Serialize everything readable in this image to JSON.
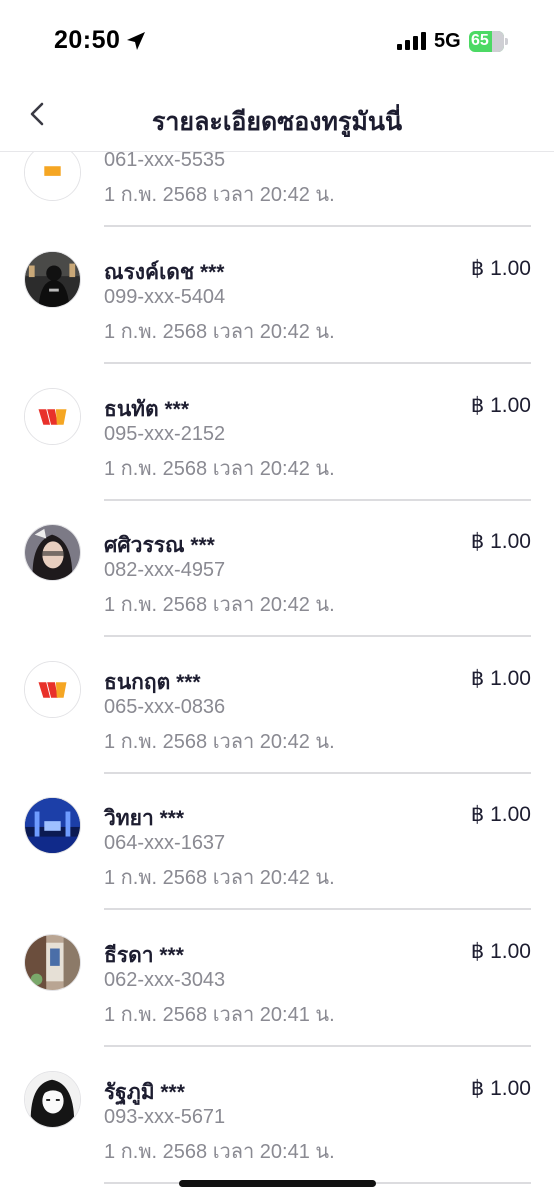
{
  "status_bar": {
    "time": "20:50",
    "network": "5G",
    "battery": "65",
    "battery_level": 0.65
  },
  "nav": {
    "title": "รายละเอียดซองทรูมันนี่",
    "back_icon": "chevron-left-icon"
  },
  "partial_row": {
    "phone": "061-xxx-5535",
    "datetime": "1 ก.พ. 2568 เวลา 20:42 น."
  },
  "rows": [
    {
      "name": "ณรงค์เดช ***",
      "amount": "฿ 1.00",
      "phone": "099-xxx-5404",
      "datetime": "1 ก.พ. 2568 เวลา 20:42 น.",
      "avatar": "photo"
    },
    {
      "name": "ธนทัต ***",
      "amount": "฿ 1.00",
      "phone": "095-xxx-2152",
      "datetime": "1 ก.พ. 2568 เวลา 20:42 น.",
      "avatar": "wallet-logo"
    },
    {
      "name": "ศศิวรรณ ***",
      "amount": "฿ 1.00",
      "phone": "082-xxx-4957",
      "datetime": "1 ก.พ. 2568 เวลา 20:42 น.",
      "avatar": "photo"
    },
    {
      "name": "ธนกฤต ***",
      "amount": "฿ 1.00",
      "phone": "065-xxx-0836",
      "datetime": "1 ก.พ. 2568 เวลา 20:42 น.",
      "avatar": "wallet-logo"
    },
    {
      "name": "วิทยา ***",
      "amount": "฿ 1.00",
      "phone": "064-xxx-1637",
      "datetime": "1 ก.พ. 2568 เวลา 20:42 น.",
      "avatar": "photo"
    },
    {
      "name": "ธีรดา ***",
      "amount": "฿ 1.00",
      "phone": "062-xxx-3043",
      "datetime": "1 ก.พ. 2568 เวลา 20:41 น.",
      "avatar": "photo"
    },
    {
      "name": "รัฐภูมิ ***",
      "amount": "฿ 1.00",
      "phone": "093-xxx-5671",
      "datetime": "1 ก.พ. 2568 เวลา 20:41 น.",
      "avatar": "photo"
    }
  ],
  "colors": {
    "text_primary": "#1d1d30",
    "text_secondary": "#8a8a92",
    "battery_green": "#4cd964",
    "logo_red": "#e8312a",
    "logo_orange": "#f5a623"
  }
}
